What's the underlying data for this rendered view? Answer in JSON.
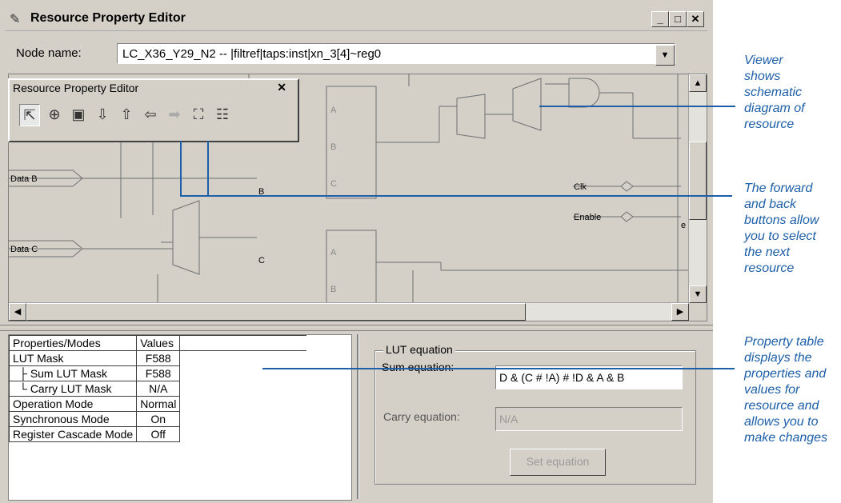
{
  "window": {
    "title": "Resource Property Editor"
  },
  "node": {
    "label": "Node name:",
    "value": "LC_X36_Y29_N2 -- |filtref|taps:inst|xn_3[4]~reg0"
  },
  "palette": {
    "title": "Resource Property Editor"
  },
  "schematic": {
    "signals": [
      "Data B",
      "Data C",
      "Clk",
      "Enable"
    ],
    "pins": [
      "B",
      "C",
      "A",
      "B",
      "C",
      "A",
      "B",
      "e"
    ]
  },
  "table": {
    "headers": [
      "Properties/Modes",
      "Values"
    ],
    "rows": [
      {
        "name": "LUT Mask",
        "value": "F588"
      },
      {
        "name": "Sum LUT Mask",
        "value": "F588"
      },
      {
        "name": "Carry LUT Mask",
        "value": "N/A"
      },
      {
        "name": "Operation Mode",
        "value": "Normal"
      },
      {
        "name": "Synchronous Mode",
        "value": "On"
      },
      {
        "name": "Register Cascade Mode",
        "value": "Off"
      }
    ]
  },
  "lut": {
    "legend": "LUT equation",
    "sum_label": "Sum equation:",
    "sum_value": "D & (C # !A) # !D & A & B",
    "carry_label": "Carry equation:",
    "carry_value": "N/A",
    "set_button": "Set equation"
  },
  "callouts": [
    [
      "Viewer",
      "shows",
      "schematic",
      "diagram of",
      "resource"
    ],
    [
      "The forward",
      "and back",
      "buttons allow",
      "you to select",
      "the next",
      "resource"
    ],
    [
      "Property table",
      "displays the",
      "properties and",
      "values for",
      "resource and",
      "allows you to",
      "make changes"
    ]
  ],
  "colors": {
    "callout": "#1d5fa8",
    "chrome": "#d4d0c8"
  }
}
